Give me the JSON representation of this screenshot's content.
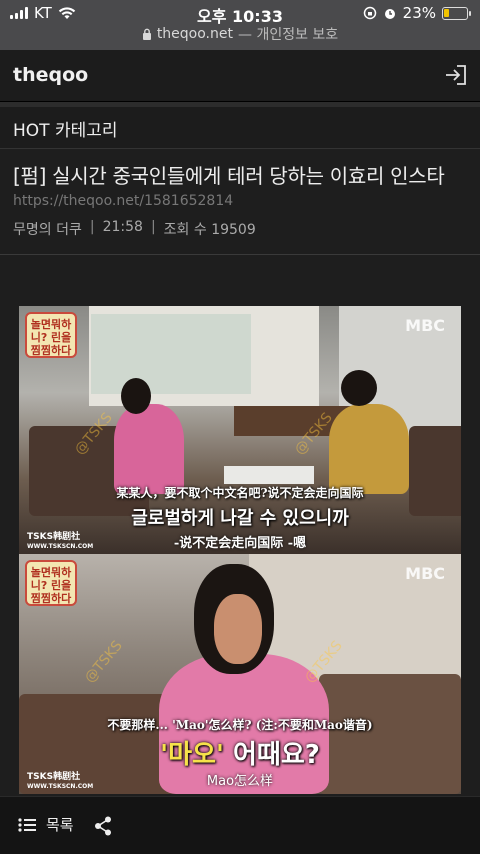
{
  "status": {
    "carrier": "KT",
    "time": "오후 10:33",
    "battery_pct": "23%",
    "battery_level": 0.23,
    "battery_color": "#f2c400"
  },
  "browser": {
    "domain": "theqoo.net",
    "suffix": "— 개인정보 보호"
  },
  "header": {
    "logo": "theqoo",
    "login_icon": "login-icon"
  },
  "category": {
    "label": "HOT 카테고리"
  },
  "post": {
    "title": "[펌] 실시간 중국인들에게 테러 당하는 이효리 인스타",
    "url": "https://theqoo.net/1581652814",
    "author": "무명의 더쿠",
    "time": "21:58",
    "views": "조회 수 19509"
  },
  "image1": {
    "show_logo": "놀면뭐하니? 린을 찜찜하다",
    "broadcaster": "MBC",
    "source_tag": "TSKS韩剧社",
    "source_url": "WWW.TSKSCN.COM",
    "caption_cn_top": "某某人，要不取个中文名吧?说不定会走向国际",
    "caption_kr": "글로벌하게 나갈 수 있으니까",
    "caption_cn_bottom": "-说不定会走向国际 -嗯"
  },
  "image2": {
    "show_logo": "놀면뭐하니? 린을 찜찜하다",
    "broadcaster": "MBC",
    "source_tag": "TSKS韩剧社",
    "source_url": "WWW.TSKSCN.COM",
    "caption_cn_top": "不要那样... 'Mao'怎么样? (注:不要和Mao谐音)",
    "caption_kr_highlight": "'마오'",
    "caption_kr_rest": " 어때요?",
    "caption_cn_bottom": "Mao怎么样"
  },
  "toolbar": {
    "list_label": "목록",
    "list_icon": "list-icon",
    "share_icon": "share-icon"
  }
}
